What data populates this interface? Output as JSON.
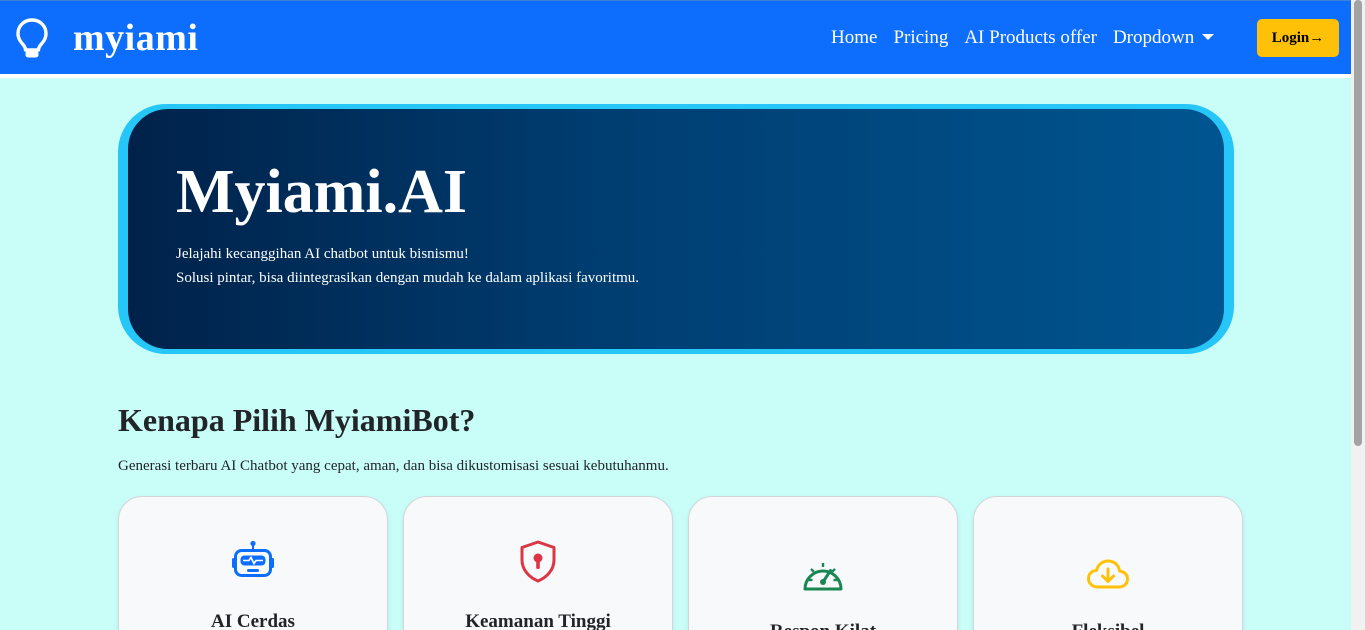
{
  "navbar": {
    "brand": "myiami",
    "brand_icon": "lightbulb-icon",
    "links": [
      "Home",
      "Pricing",
      "AI Products offer",
      "Dropdown"
    ],
    "login_label": "Login→",
    "bg_color": "#0d6efd",
    "login_color": "#ffc107"
  },
  "hero": {
    "title": "Myiami.AI",
    "line1": "Jelajahi kecanggihan AI chatbot untuk bisnismu!",
    "line2": "Solusi pintar, bisa diintegrasikan dengan mudah ke dalam aplikasi favoritmu.",
    "border_color": "#26c6f9"
  },
  "why": {
    "title": "Kenapa Pilih MyiamiBot?",
    "subtitle": "Generasi terbaru AI Chatbot yang cepat, aman, dan bisa dikustomisasi sesuai kebutuhanmu."
  },
  "features": [
    {
      "title": "AI Cerdas",
      "icon": "robot-icon",
      "color": "#0d6efd"
    },
    {
      "title": "Keamanan Tinggi",
      "icon": "shield-lock-icon",
      "color": "#dc3545"
    },
    {
      "title": "Respon Kilat",
      "icon": "speedometer-icon",
      "color": "#198754"
    },
    {
      "title": "Fleksibel",
      "icon": "cloud-download-icon",
      "color": "#ffc107"
    }
  ],
  "page_bg": "#c8fdf8"
}
